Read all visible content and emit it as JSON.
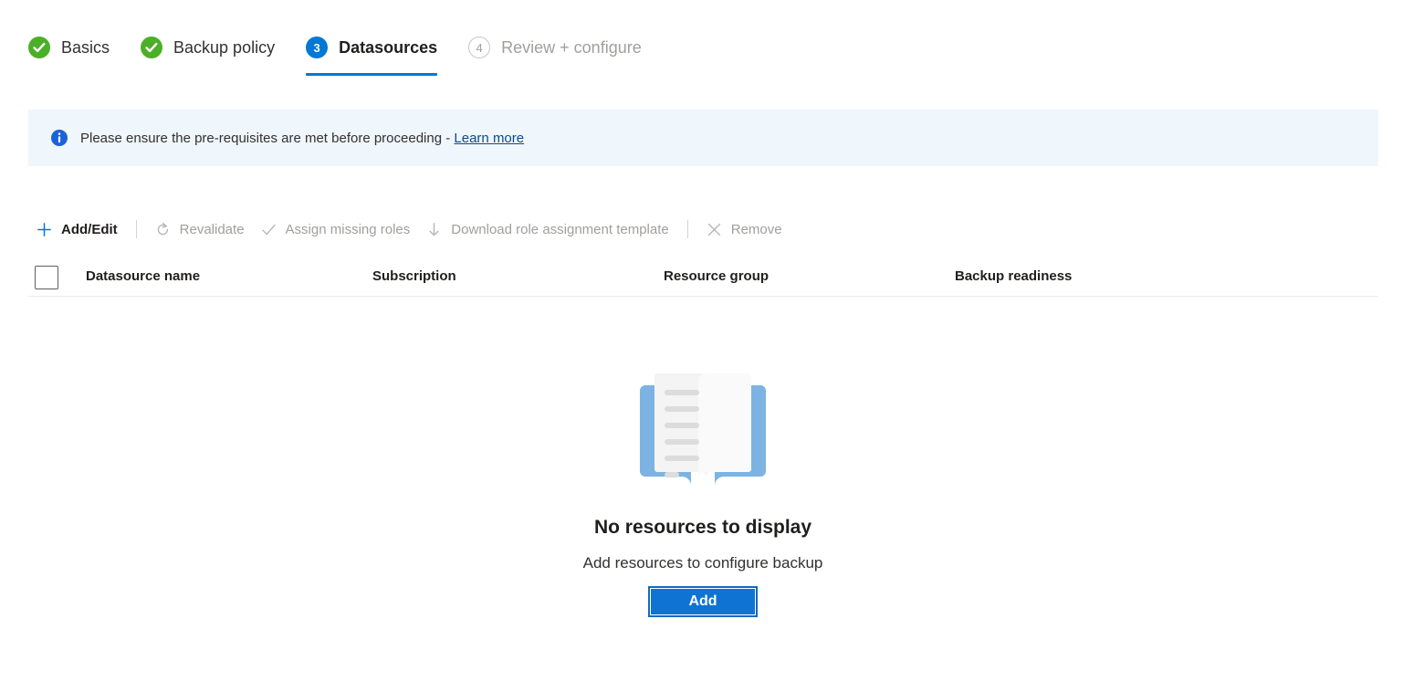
{
  "wizard": {
    "steps": [
      {
        "label": "Basics",
        "state": "done",
        "number": "1",
        "icon": "check-circle-icon"
      },
      {
        "label": "Backup policy",
        "state": "done",
        "number": "2",
        "icon": "check-circle-icon"
      },
      {
        "label": "Datasources",
        "state": "current",
        "number": "3",
        "icon": "step-number-icon"
      },
      {
        "label": "Review + configure",
        "state": "upcoming",
        "number": "4",
        "icon": "step-number-icon"
      }
    ]
  },
  "banner": {
    "icon": "info-icon",
    "message": "Please ensure the pre-requisites are met before proceeding - ",
    "link_label": "Learn more"
  },
  "toolbar": {
    "items": [
      {
        "label": "Add/Edit",
        "icon": "plus-icon",
        "enabled": true
      },
      {
        "label": "Revalidate",
        "icon": "refresh-icon",
        "enabled": false
      },
      {
        "label": "Assign missing roles",
        "icon": "checkmark-icon",
        "enabled": false
      },
      {
        "label": "Download role assignment template",
        "icon": "download-arrow-icon",
        "enabled": false
      },
      {
        "label": "Remove",
        "icon": "close-x-icon",
        "enabled": false
      }
    ]
  },
  "table": {
    "select_all_checked": false,
    "columns": [
      {
        "label": "Datasource name"
      },
      {
        "label": "Subscription"
      },
      {
        "label": "Resource group"
      },
      {
        "label": "Backup readiness"
      }
    ],
    "rows": []
  },
  "empty_state": {
    "illustration": "open-book-icon",
    "title": "No resources to display",
    "subtitle": "Add resources to configure backup",
    "button_label": "Add"
  },
  "colors": {
    "accent": "#0078d4",
    "success": "#4caf28",
    "banner_bg": "#eff6fc",
    "link": "#0f4a8a",
    "disabled_text": "#a19f9d",
    "button_bg": "#0f73d4"
  }
}
